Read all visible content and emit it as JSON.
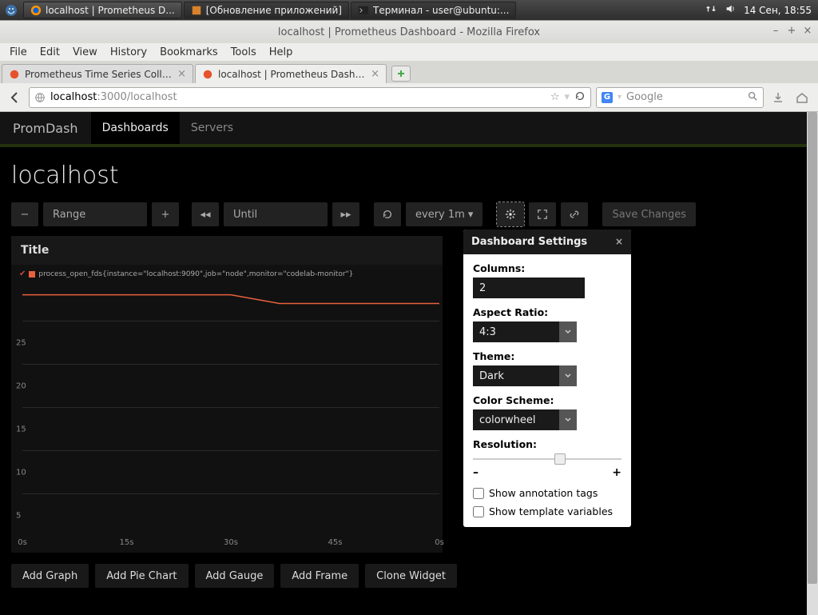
{
  "panel": {
    "tasks": [
      {
        "label": "localhost | Prometheus D...",
        "active": true
      },
      {
        "label": "[Обновление приложений]",
        "active": false
      },
      {
        "label": "Терминал - user@ubuntu:...",
        "active": false
      }
    ],
    "clock": "14 Сен, 18:55"
  },
  "window": {
    "title": "localhost | Prometheus Dashboard - Mozilla Firefox",
    "menu": [
      "File",
      "Edit",
      "View",
      "History",
      "Bookmarks",
      "Tools",
      "Help"
    ],
    "tabs": [
      {
        "label": "Prometheus Time Series Collecti...",
        "active": false
      },
      {
        "label": "localhost | Prometheus Dashbo...",
        "active": true
      }
    ],
    "url_host": "localhost",
    "url_port_path": ":3000/localhost",
    "search_placeholder": "Google"
  },
  "promdash": {
    "brand": "PromDash",
    "nav": {
      "dashboards": "Dashboards",
      "servers": "Servers"
    },
    "page_title": "localhost",
    "controls": {
      "range": "Range",
      "until": "Until",
      "refresh": "every 1m",
      "save": "Save Changes"
    },
    "chart": {
      "title": "Title",
      "legend": "process_open_fds{instance=\"localhost:9090\",job=\"node\",monitor=\"codelab-monitor\"}"
    },
    "actions": {
      "add_graph": "Add Graph",
      "add_pie": "Add Pie Chart",
      "add_gauge": "Add Gauge",
      "add_frame": "Add Frame",
      "clone": "Clone Widget"
    }
  },
  "settings": {
    "title": "Dashboard Settings",
    "columns_label": "Columns:",
    "columns_value": "2",
    "aspect_label": "Aspect Ratio:",
    "aspect_value": "4:3",
    "theme_label": "Theme:",
    "theme_value": "Dark",
    "scheme_label": "Color Scheme:",
    "scheme_value": "colorwheel",
    "resolution_label": "Resolution:",
    "slider_min": "–",
    "slider_max": "+",
    "annot_label": "Show annotation tags",
    "tmpl_label": "Show template variables"
  },
  "chart_data": {
    "type": "line",
    "title": "Title",
    "xlabel": "",
    "ylabel": "",
    "ylim": [
      0,
      30
    ],
    "yticks": [
      5,
      10,
      15,
      20,
      25
    ],
    "xticks": [
      "0s",
      "15s",
      "30s",
      "45s",
      "0s"
    ],
    "series": [
      {
        "name": "process_open_fds{instance=\"localhost:9090\",job=\"node\",monitor=\"codelab-monitor\"}",
        "color": "#e8613c",
        "x": [
          0,
          15,
          30,
          37,
          45,
          60
        ],
        "y": [
          28,
          28,
          28,
          27,
          27,
          27
        ]
      }
    ]
  }
}
